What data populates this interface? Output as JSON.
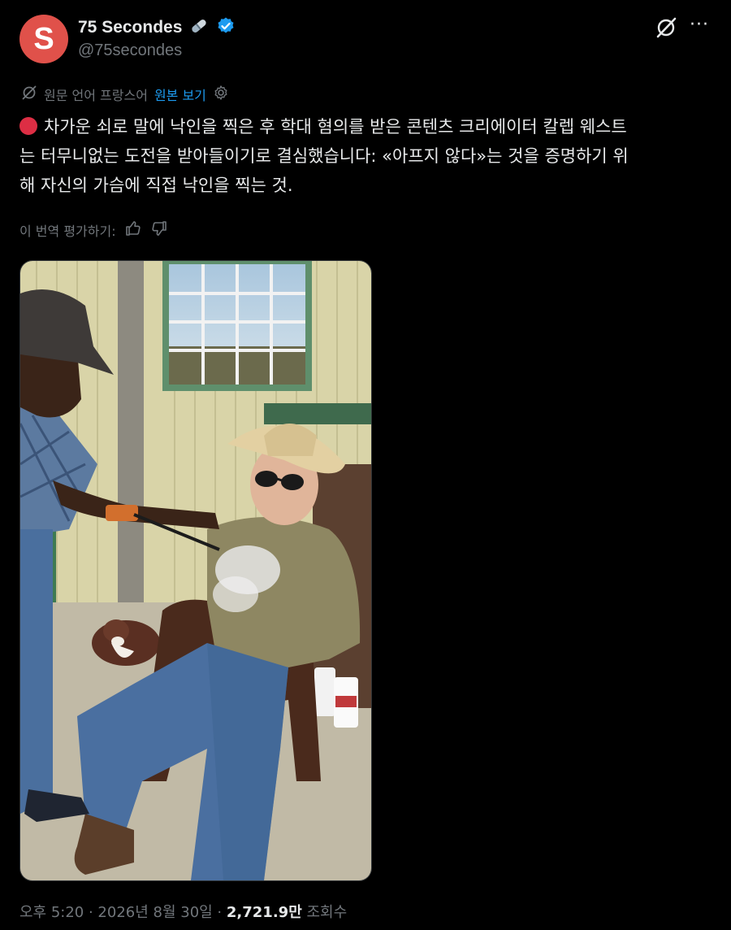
{
  "author": {
    "avatar_letter": "S",
    "name": "75 Secondes",
    "handle": "@75secondes",
    "brand_color": "#e0514a",
    "verified_color": "#1d9bf0"
  },
  "translation": {
    "source_language": "원문 언어 프랑스어",
    "show_original": "원본 보기"
  },
  "post": {
    "text_line1": "차가운 쇠로 말에 낙인을 찍은 후 학대 혐의를 받은 콘텐츠 크리에이터 칼렙 웨스트",
    "text_line2": "는 터무니없는 도전을 받아들이기로 결심했습니다: «아프지 않다»는 것을 증명하기 위",
    "text_line3": "해 자신의 가슴에 직접 낙인을 찍는 것."
  },
  "rating": {
    "label": "이 번역 평가하기:"
  },
  "meta": {
    "time_date": "오후 5:20 · 2026년 8월 30일 · ",
    "views_count": "2,721.9만",
    "views_label": " 조회수"
  },
  "icons": {
    "more": "more-icon",
    "grok": "grok-icon",
    "verified": "verified-badge-icon",
    "pill": "pill-emoji-icon",
    "thumbs_up": "thumbs-up-icon",
    "thumbs_down": "thumbs-down-icon",
    "settings": "gear-icon",
    "translate": "translate-icon"
  }
}
